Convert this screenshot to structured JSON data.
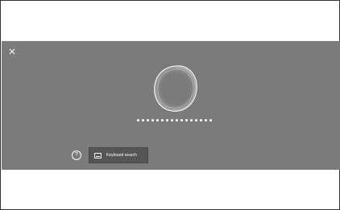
{
  "overlay": {
    "close_icon": "close-icon",
    "help_label": "?",
    "keyboard_search_label": "Keyboard search",
    "keyboard_icon": "keyboard-icon",
    "orb_icon": "voice-listening-orb",
    "listening_dots": 16
  },
  "colors": {
    "overlay_bg": "#7b7b7b",
    "button_bg": "#555555",
    "foreground": "#ffffff"
  }
}
